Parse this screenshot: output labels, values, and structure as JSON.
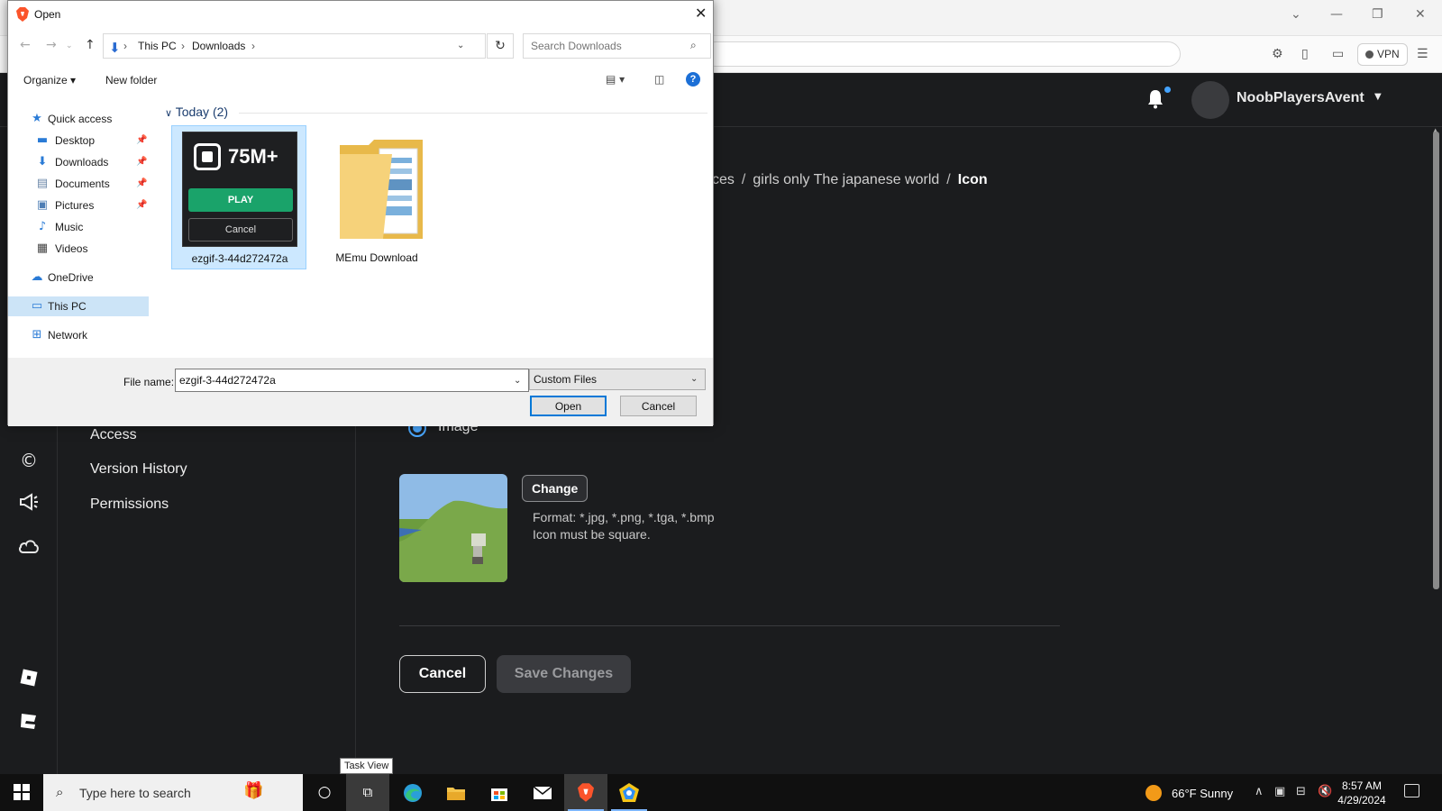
{
  "browser": {
    "vpn_label": "VPN",
    "window_controls": [
      "⌄",
      "—",
      "❐",
      "✕"
    ]
  },
  "site": {
    "username": "NoobPlayersAvent",
    "breadcrumb": {
      "parts": [
        "ces",
        "girls only The japanese world"
      ],
      "current": "Icon",
      "separator": "/"
    },
    "side_menu": [
      "Access",
      "Version History",
      "Permissions"
    ],
    "radio_label": "Image",
    "change_label": "Change",
    "format_line1": "Format: *.jpg, *.png, *.tga, *.bmp",
    "format_line2": "Icon must be square.",
    "cancel_label": "Cancel",
    "save_label": "Save Changes"
  },
  "dialog": {
    "title": "Open",
    "address": {
      "pc": "This PC",
      "folder": "Downloads"
    },
    "search_placeholder": "Search Downloads",
    "organize_label": "Organize ▾",
    "new_folder_label": "New folder",
    "help_label": "?",
    "nav": {
      "quick_access": "Quick access",
      "desktop": "Desktop",
      "downloads": "Downloads",
      "documents": "Documents",
      "pictures": "Pictures",
      "music": "Music",
      "videos": "Videos",
      "onedrive": "OneDrive",
      "this_pc": "This PC",
      "network": "Network"
    },
    "group_header": "Today (2)",
    "files": [
      {
        "name": "ezgif-3-44d272472a",
        "badge": "75M+",
        "play": "PLAY",
        "cancel": "Cancel"
      },
      {
        "name": "MEmu Download"
      }
    ],
    "file_name_label": "File name:",
    "file_name_value": "ezgif-3-44d272472a",
    "filter_value": "Custom Files",
    "open_label": "Open",
    "cancel_label": "Cancel"
  },
  "tooltip": "Task View",
  "taskbar": {
    "search_placeholder": "Type here to search",
    "weather": "66°F  Sunny",
    "time": "8:57 AM",
    "date": "4/29/2024"
  },
  "colors": {
    "accent_blue": "#4aa8ff",
    "brave_orange": "#fb542b",
    "roblox_green": "#1aa36a",
    "site_bg": "#1b1c1e"
  }
}
